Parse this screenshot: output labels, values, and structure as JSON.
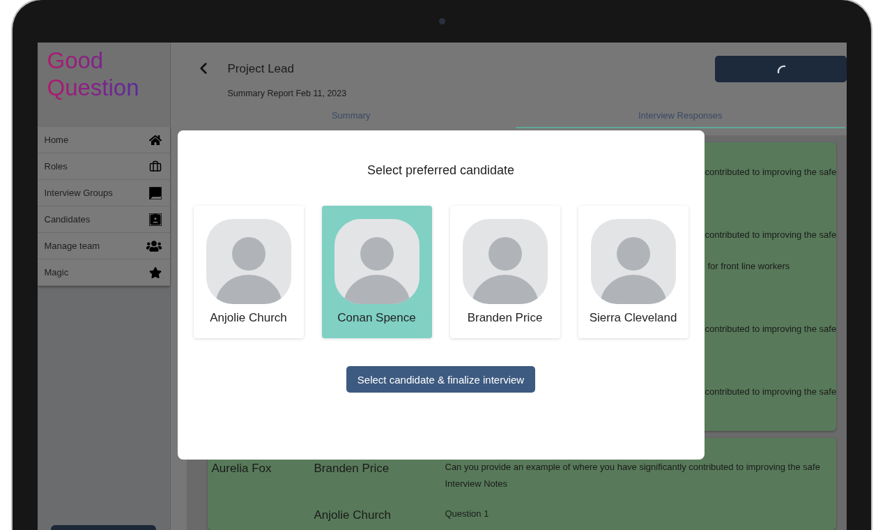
{
  "sidebar": {
    "logo": "Good Question",
    "items": [
      {
        "label": "Home"
      },
      {
        "label": "Roles"
      },
      {
        "label": "Interview Groups"
      },
      {
        "label": "Candidates"
      },
      {
        "label": "Manage team"
      },
      {
        "label": "Magic"
      }
    ]
  },
  "header": {
    "title": "Project Lead",
    "subtitle": "Summary Report Feb 11, 2023",
    "loading": true
  },
  "tabs": [
    {
      "label": "Summary",
      "selected": false
    },
    {
      "label": "Interview Responses",
      "selected": true
    }
  ],
  "responses": {
    "first_card": [
      {
        "lines": [
          "contributed to improving the safe"
        ]
      },
      {
        "lines": [
          "contributed to improving the safe",
          "for front line workers"
        ]
      },
      {
        "lines": [
          "contributed to improving the safe"
        ]
      },
      {
        "lines": [
          "contributed to improving the safe"
        ]
      }
    ],
    "second_card": [
      {
        "interviewer": "Aurelia Fox",
        "candidate": "Branden Price",
        "lines": [
          "Can you provide an example of where you have significantly contributed to improving the safe",
          "Interview Notes"
        ]
      },
      {
        "candidate": "Anjolie Church",
        "lines": [
          "Question 1"
        ]
      }
    ]
  },
  "modal": {
    "title": "Select preferred candidate",
    "candidates": [
      {
        "name": "Anjolie Church",
        "selected": false
      },
      {
        "name": "Conan Spence",
        "selected": true
      },
      {
        "name": "Branden Price",
        "selected": false
      },
      {
        "name": "Sierra Cleveland",
        "selected": false
      }
    ],
    "button": "Select candidate & finalize interview"
  }
}
